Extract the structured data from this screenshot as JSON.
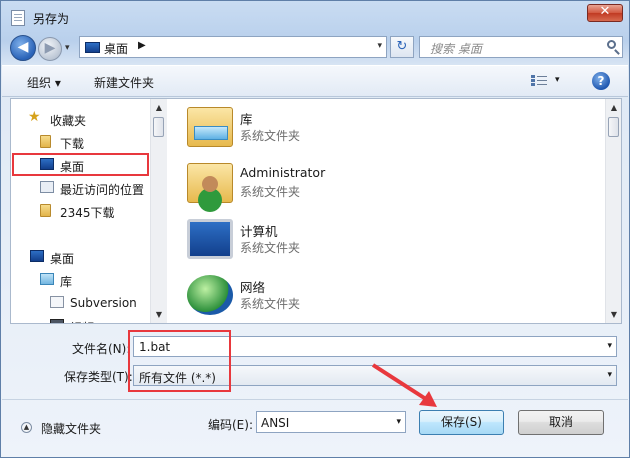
{
  "window": {
    "title": "另存为",
    "close_symbol": "✕"
  },
  "nav": {
    "back_symbol": "◀",
    "forward_symbol": "▶",
    "address_path": "桌面",
    "address_sep": "▶",
    "refresh_symbol": "↻",
    "search_placeholder": "搜索 桌面"
  },
  "toolbar": {
    "organize": "组织 ▾",
    "new_folder": "新建文件夹",
    "view_drop": "▾",
    "help": "?"
  },
  "sidebar": {
    "items": [
      {
        "label": "收藏夹"
      },
      {
        "label": "下载"
      },
      {
        "label": "桌面"
      },
      {
        "label": "最近访问的位置"
      },
      {
        "label": "2345下载"
      },
      {
        "label": "桌面"
      },
      {
        "label": "库"
      },
      {
        "label": "Subversion"
      },
      {
        "label": "视频"
      }
    ]
  },
  "files": [
    {
      "name": "库",
      "type": "系统文件夹"
    },
    {
      "name": "Administrator",
      "type": "系统文件夹"
    },
    {
      "name": "计算机",
      "type": "系统文件夹"
    },
    {
      "name": "网络",
      "type": "系统文件夹"
    }
  ],
  "form": {
    "filename_label": "文件名(N):",
    "filename_value": "1.bat",
    "filetype_label": "保存类型(T):",
    "filetype_value": "所有文件 (*.*)",
    "hide_folders": "隐藏文件夹",
    "encoding_label": "编码(E):",
    "encoding_value": "ANSI",
    "save": "保存(S)",
    "cancel": "取消"
  },
  "colors": {
    "highlight_red": "#e8383d"
  }
}
